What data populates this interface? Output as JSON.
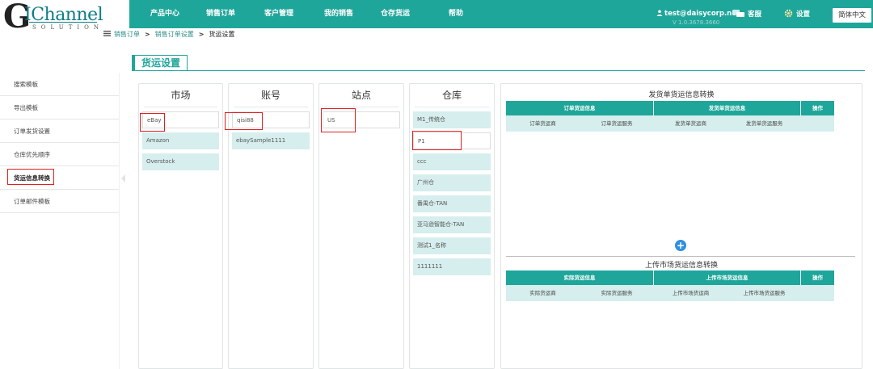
{
  "logo": {
    "g": "G",
    "name": "IChannel",
    "sub": "SOLUTION"
  },
  "nav": [
    "产品中心",
    "销售订单",
    "客户管理",
    "我的销售",
    "仓存货运",
    "帮助"
  ],
  "header": {
    "user": "test@daisycorp.net",
    "version": "V 1.0.3678.3660",
    "service": "客服",
    "settings": "设置",
    "language": "简体中文"
  },
  "breadcrumb": {
    "items": [
      "销售订单",
      "销售订单设置",
      "货运设置"
    ]
  },
  "sidebar": {
    "items": [
      "搜索模板",
      "导出模板",
      "订单发货设置",
      "仓库优先顺序",
      "货运信息转换",
      "订单邮件模板"
    ],
    "active_index": 4
  },
  "section_title": "货运设置",
  "columns": {
    "market": {
      "title": "市场",
      "items": [
        "eBay",
        "Amazon",
        "Overstock"
      ],
      "selected": 0
    },
    "account": {
      "title": "账号",
      "items": [
        "qisi88",
        "ebaySample1111"
      ],
      "selected": 0
    },
    "site": {
      "title": "站点",
      "items": [
        "US"
      ],
      "selected": 0
    },
    "warehouse": {
      "title": "仓库",
      "items": [
        "M1_传统仓",
        "P1",
        "ccc",
        "广州仓",
        "番禺仓-TAN",
        "亚马逊智能仓-TAN",
        "测试1_名称",
        "1111111"
      ],
      "selected": 1
    }
  },
  "shipping_convert": {
    "title": "发货单货运信息转换",
    "groups": [
      "订单货运信息",
      "发货单货运信息",
      "操作"
    ],
    "subheaders": [
      "订单货运商",
      "订单货运服务",
      "发货单货运商",
      "发货单货运服务"
    ]
  },
  "upload_convert": {
    "title": "上传市场货运信息转换",
    "groups": [
      "实际货运信息",
      "上传市场货运信息",
      "操作"
    ],
    "subheaders": [
      "实际货运商",
      "实际货运服务",
      "上传市场货运商",
      "上传市场货运服务"
    ]
  },
  "add_button": "+"
}
